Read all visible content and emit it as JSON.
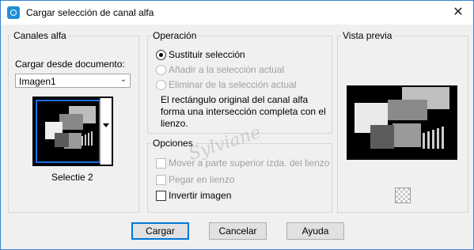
{
  "window": {
    "title": "Cargar selección de canal alfa",
    "close_label": "✕"
  },
  "channels": {
    "panel_title": "Canales alfa",
    "load_from_label": "Cargar desde documento:",
    "document_value": "Imagen1",
    "thumb_caption": "Selectie 2"
  },
  "operation": {
    "panel_title": "Operación",
    "options": [
      {
        "label": "Sustituir selección",
        "checked": true,
        "enabled": true
      },
      {
        "label": "Añadir a la selección actual",
        "checked": false,
        "enabled": false
      },
      {
        "label": "Eliminar de la selección actual",
        "checked": false,
        "enabled": false
      }
    ],
    "description": "El rectángulo original del canal alfa forma una intersección completa con el lienzo."
  },
  "options": {
    "panel_title": "Opciones",
    "items": [
      {
        "label": "Mover a parte superior izda. del lienzo",
        "checked": false,
        "enabled": false
      },
      {
        "label": "Pegar en lienzo",
        "checked": false,
        "enabled": false
      },
      {
        "label": "Invertir imagen",
        "checked": false,
        "enabled": true
      }
    ]
  },
  "preview": {
    "panel_title": "Vista previa"
  },
  "buttons": {
    "ok": "Cargar",
    "cancel": "Cancelar",
    "help": "Ayuda"
  },
  "watermark": "Sylviane"
}
